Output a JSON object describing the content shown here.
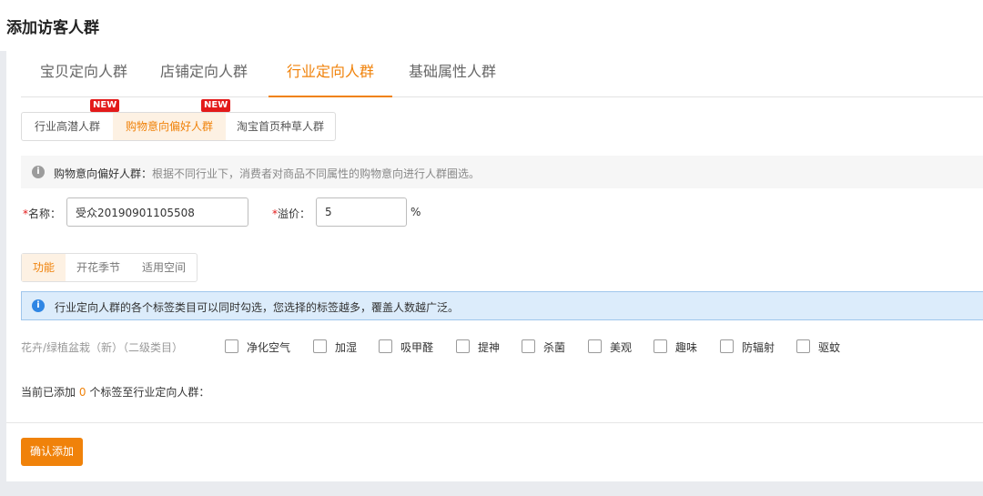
{
  "page_title": "添加访客人群",
  "main_tabs": [
    {
      "label": "宝贝定向人群"
    },
    {
      "label": "店铺定向人群"
    },
    {
      "label": "行业定向人群"
    },
    {
      "label": "基础属性人群"
    }
  ],
  "sub_tabs": [
    {
      "label": "行业高潜人群",
      "badge": "NEW"
    },
    {
      "label": "购物意向偏好人群",
      "badge": "NEW"
    },
    {
      "label": "淘宝首页种草人群"
    }
  ],
  "info": {
    "icon": "info-icon",
    "title": "购物意向偏好人群：",
    "text": "根据不同行业下，消费者对商品不同属性的购物意向进行人群圈选。"
  },
  "form": {
    "required_mark": "*",
    "name_label": "名称：",
    "name_value": "受众20190901105508",
    "premium_label": "溢价：",
    "premium_value": "5",
    "premium_unit": "%"
  },
  "attr_tabs": [
    {
      "label": "功能"
    },
    {
      "label": "开花季节"
    },
    {
      "label": "适用空间"
    }
  ],
  "notice": {
    "icon": "info-icon",
    "text": "行业定向人群的各个标签类目可以同时勾选，您选择的标签越多，覆盖人数越广泛。"
  },
  "category": {
    "label": "花卉/绿植盆栽（新）（二级类目）",
    "options": [
      {
        "label": "净化空气",
        "checked": false
      },
      {
        "label": "加湿",
        "checked": false
      },
      {
        "label": "吸甲醛",
        "checked": false
      },
      {
        "label": "提神",
        "checked": false
      },
      {
        "label": "杀菌",
        "checked": false
      },
      {
        "label": "美观",
        "checked": false
      },
      {
        "label": "趣味",
        "checked": false
      },
      {
        "label": "防辐射",
        "checked": false
      },
      {
        "label": "驱蚊",
        "checked": false
      }
    ]
  },
  "summary": {
    "prefix": "当前已添加",
    "count": "0",
    "suffix": "个标签至行业定向人群："
  },
  "confirm_button": "确认添加",
  "colors": {
    "accent": "#f0820a",
    "badge": "#e31a1a",
    "notice_bg": "#dcecfb",
    "notice_icon": "#2f86e4"
  }
}
